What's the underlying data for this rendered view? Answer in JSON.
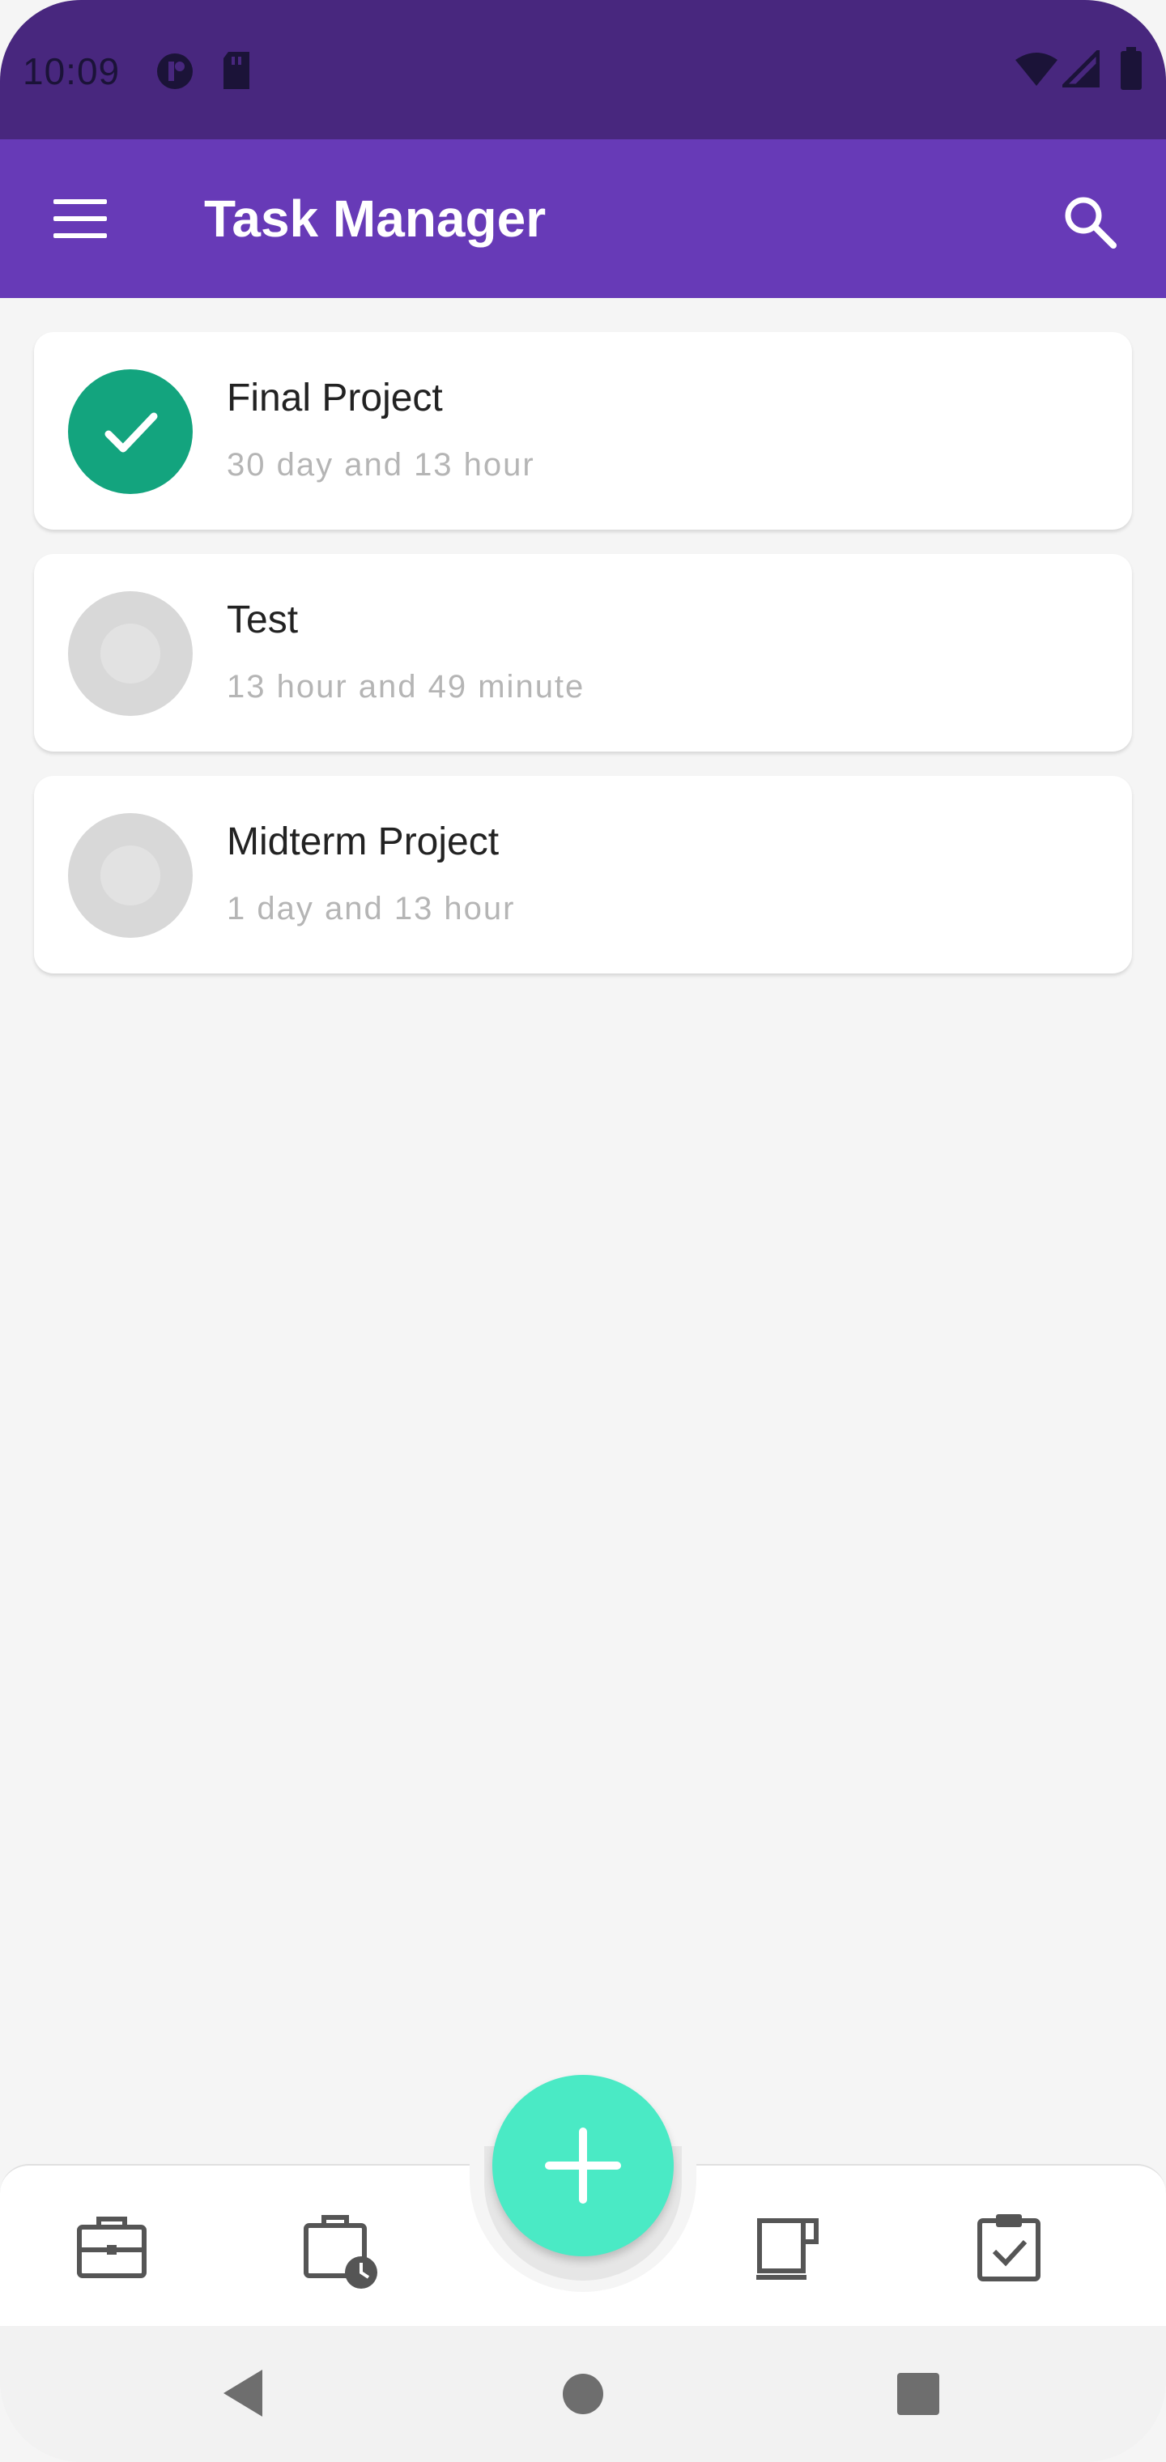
{
  "status_bar": {
    "time": "10:09",
    "icons": [
      "data-saver-icon",
      "sd-card-icon",
      "wifi-icon",
      "signal-icon",
      "battery-icon"
    ]
  },
  "app_bar": {
    "title": "Task Manager",
    "menu_icon": "menu-icon",
    "search_icon": "search-icon",
    "color": "#673ab7"
  },
  "tasks": [
    {
      "title": "Final Project",
      "subtitle": "30 day and 13 hour",
      "completed": true
    },
    {
      "title": "Test",
      "subtitle": "13 hour and 49 minute",
      "completed": false
    },
    {
      "title": "Midterm Project",
      "subtitle": "1 day and 13 hour",
      "completed": false
    }
  ],
  "bottom_nav": {
    "items": [
      "briefcase-icon",
      "calendar-clock-icon",
      "coffee-cup-icon",
      "clipboard-check-icon"
    ],
    "fab_icon": "plus-icon",
    "fab_color": "#4aeac5"
  },
  "system_nav": {
    "buttons": [
      "back-icon",
      "home-icon",
      "recents-icon"
    ]
  },
  "colors": {
    "status_bar": "#48277e",
    "completed": "#13a47e",
    "background": "#f5f5f5"
  }
}
